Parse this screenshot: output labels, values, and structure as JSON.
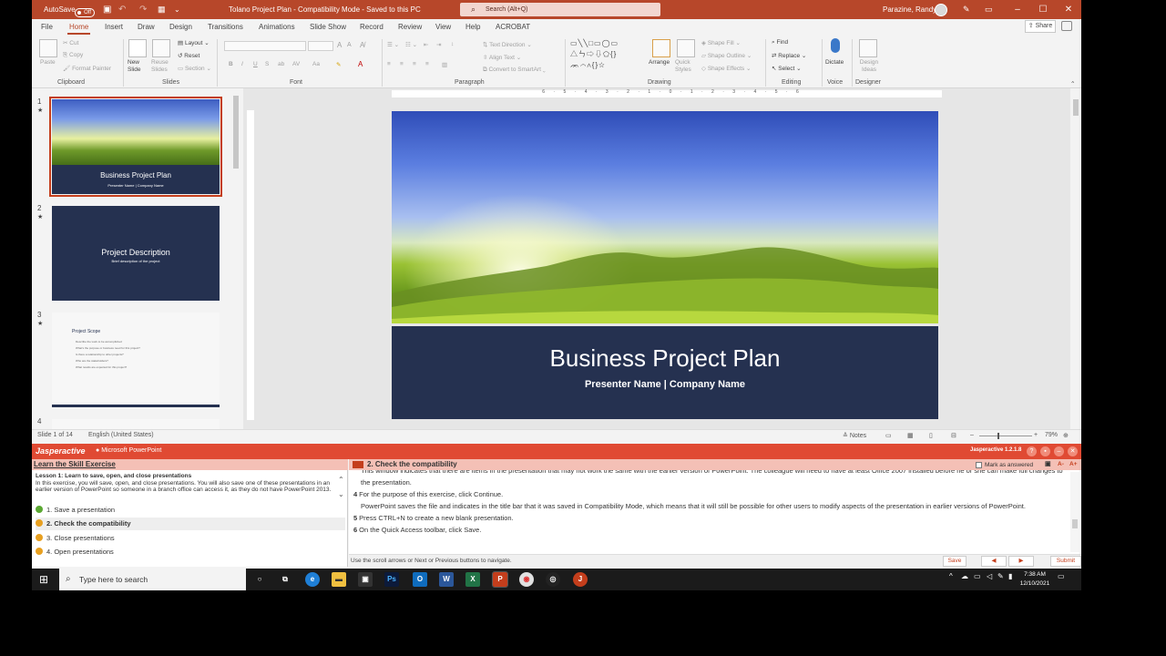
{
  "titlebar": {
    "autosave_label": "AutoSave",
    "autosave_state": "Off",
    "doc_title": "Tolano Project Plan  -  Compatibility Mode  -  Saved to this PC",
    "search_placeholder": "Search (Alt+Q)",
    "user_name": "Parazine, Randy"
  },
  "tabs": [
    "File",
    "Home",
    "Insert",
    "Draw",
    "Design",
    "Transitions",
    "Animations",
    "Slide Show",
    "Record",
    "Review",
    "View",
    "Help",
    "ACROBAT"
  ],
  "active_tab": "Home",
  "share_label": "Share",
  "ribbon": {
    "groups": [
      "Clipboard",
      "Slides",
      "Font",
      "Paragraph",
      "Drawing",
      "Editing",
      "Voice",
      "Designer"
    ],
    "paste": "Paste",
    "cut": "Cut",
    "copy": "Copy",
    "format_painter": "Format Painter",
    "new_slide": "New Slide",
    "reuse_slides": "Reuse Slides",
    "layout": "Layout",
    "reset": "Reset",
    "section": "Section",
    "text_direction": "Text Direction",
    "align_text": "Align Text",
    "convert_smartart": "Convert to SmartArt",
    "arrange": "Arrange",
    "quick_styles": "Quick Styles",
    "shape_fill": "Shape Fill",
    "shape_outline": "Shape Outline",
    "shape_effects": "Shape Effects",
    "find": "Find",
    "replace": "Replace",
    "select": "Select",
    "dictate": "Dictate",
    "design_ideas": "Design Ideas"
  },
  "thumbnails": [
    {
      "num": "1",
      "title": "Business Project Plan",
      "subtitle": "Presenter Name | Company Name"
    },
    {
      "num": "2",
      "title": "Project Description",
      "subtitle": "Brief description of the project"
    },
    {
      "num": "3",
      "title": "Project Scope",
      "bullets": [
        "Describe the work to be accomplished",
        "What's the purpose or business need for this project?",
        "Is there a relationship to other projects?",
        "Who are the stakeholders?",
        "What results are expected for this project?"
      ]
    },
    {
      "num": "4"
    }
  ],
  "slide": {
    "title": "Business Project Plan",
    "subtitle": "Presenter Name | Company Name"
  },
  "ruler_marks": "6 · 5 · 4 · 3 · 2 · 1 · 0 · 1 · 2 · 3 · 4 · 5 · 6",
  "statusbar": {
    "slide_counter": "Slide 1 of 14",
    "language": "English (United States)",
    "notes": "Notes",
    "zoom": "79%"
  },
  "jasper": {
    "logo": "Jasperactive",
    "app": "Microsoft PowerPoint",
    "version": "Jasperactive 1.2.1.8",
    "left_header": "Learn the Skill Exercise",
    "lesson_title": "Lesson 1: Learn to save, open, and close presentations",
    "lesson_desc": "In this exercise, you will save, open, and close presentations. You will also save one of these presentations in an earlier version of PowerPoint so someone in a branch office can access it, as they do not have PowerPoint 2013.",
    "tasks": [
      {
        "label": "1. Save a presentation",
        "status": "done"
      },
      {
        "label": "2. Check the compatibility",
        "status": "active"
      },
      {
        "label": "3. Close presentations",
        "status": "pending"
      },
      {
        "label": "4. Open presentations",
        "status": "pending"
      }
    ],
    "right_header": "2. Check the compatibility",
    "mark_answered": "Mark as answered",
    "steps": [
      {
        "n": "",
        "text": "This window indicates that there are items in the presentation that may not work the same with the earlier version of PowerPoint. The colleague will need to have at least Office 2007 installed before he or she can make full changes to the presentation."
      },
      {
        "n": "4",
        "text": "For the purpose of this exercise, click Continue."
      },
      {
        "n": "",
        "text": "PowerPoint saves the file and indicates in the title bar that it was saved in Compatibility Mode, which means that it will still be possible for other users to modify aspects of the presentation in earlier versions of PowerPoint."
      },
      {
        "n": "5",
        "text": "Press CTRL+N to create a new blank presentation."
      },
      {
        "n": "6",
        "text": "On the Quick Access toolbar, click Save."
      }
    ],
    "footer_hint": "Use the scroll arrows or Next or Previous buttons to navigate.",
    "save": "Save",
    "submit": "Submit"
  },
  "taskbar": {
    "search_placeholder": "Type here to search",
    "time": "7:38 AM",
    "date": "12/10/2021"
  }
}
